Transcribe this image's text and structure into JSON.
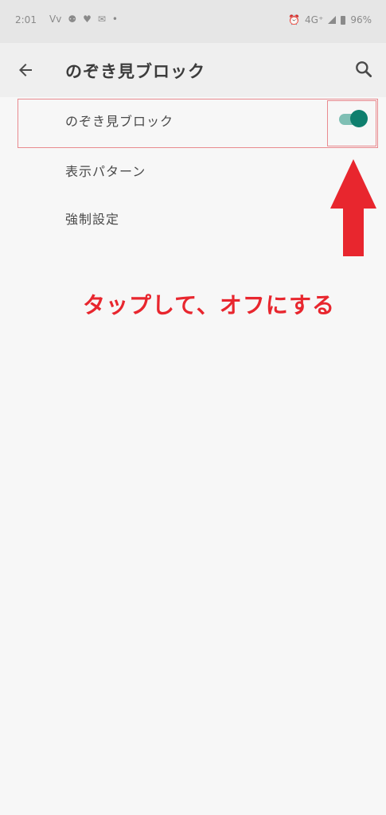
{
  "status_bar": {
    "time": "2:01",
    "notifications": [
      "Vv",
      "⚉",
      "♥",
      "✉",
      "•"
    ],
    "alarm": "⏰",
    "network": "4G⁺",
    "battery": "96%"
  },
  "app_bar": {
    "title": "のぞき見ブロック",
    "back_icon": "arrow-left-icon",
    "search_icon": "search-icon"
  },
  "settings": {
    "items": [
      {
        "label": "のぞき見ブロック",
        "toggle": "on"
      },
      {
        "label": "表示パターン"
      },
      {
        "label": "強制設定"
      }
    ]
  },
  "annotation": {
    "text": "タップして、オフにする",
    "color": "#e8262e"
  },
  "colors": {
    "accent": "#0f7f6e",
    "highlight_border": "#e98a8f"
  }
}
